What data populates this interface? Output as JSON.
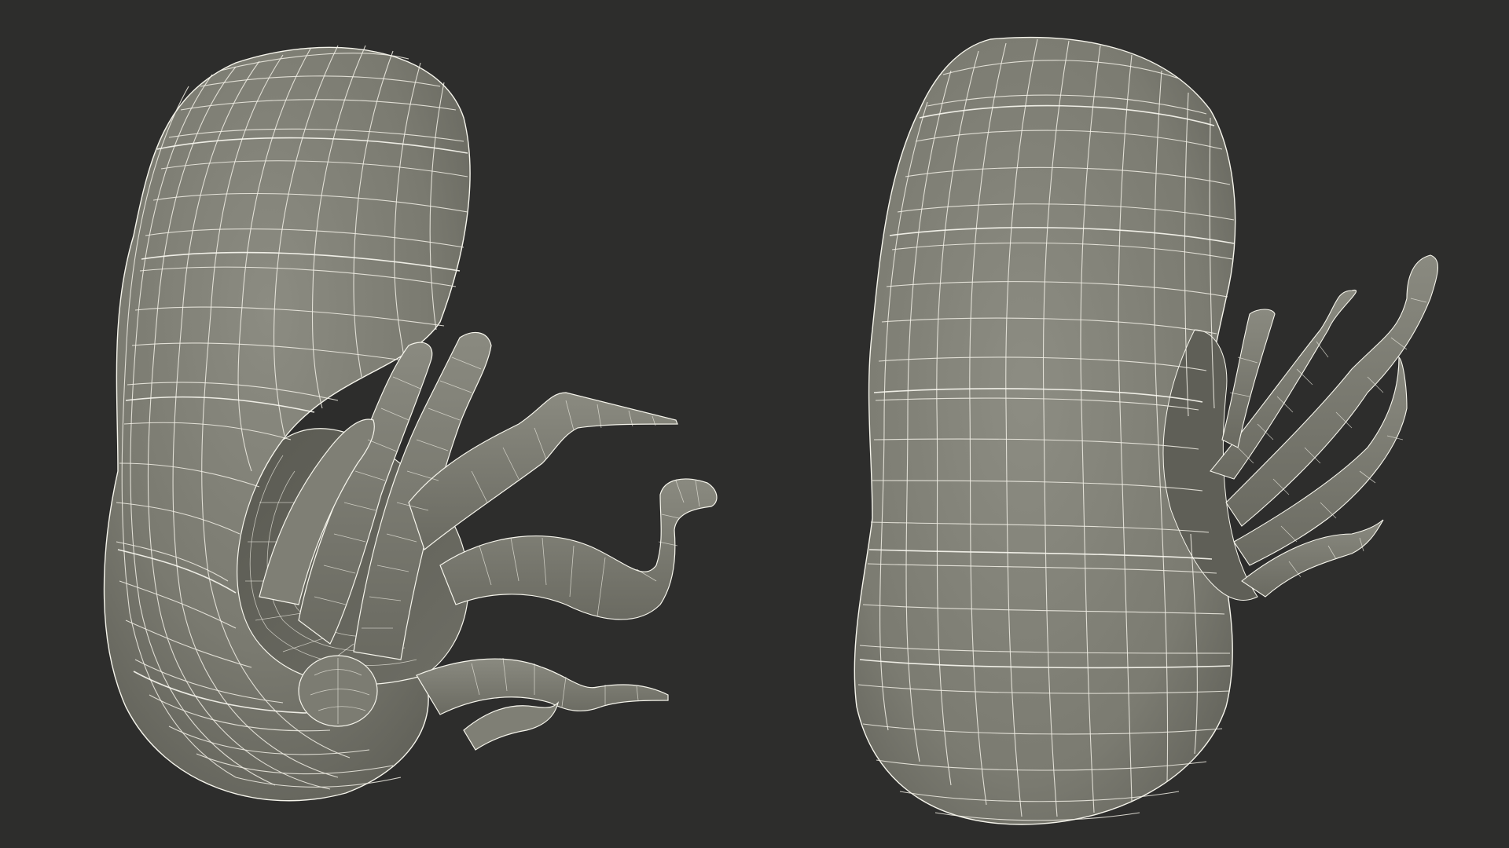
{
  "scene": {
    "background_color": "#2d2d2c",
    "mesh_fill_color": "#7d7d72",
    "mesh_shadow_color": "#55554d",
    "mesh_highlight_color": "#8e8e84",
    "wire_color": "#f2f0e6"
  },
  "views": [
    {
      "id": "view-left",
      "description_visible": false
    },
    {
      "id": "view-right",
      "description_visible": false
    }
  ]
}
